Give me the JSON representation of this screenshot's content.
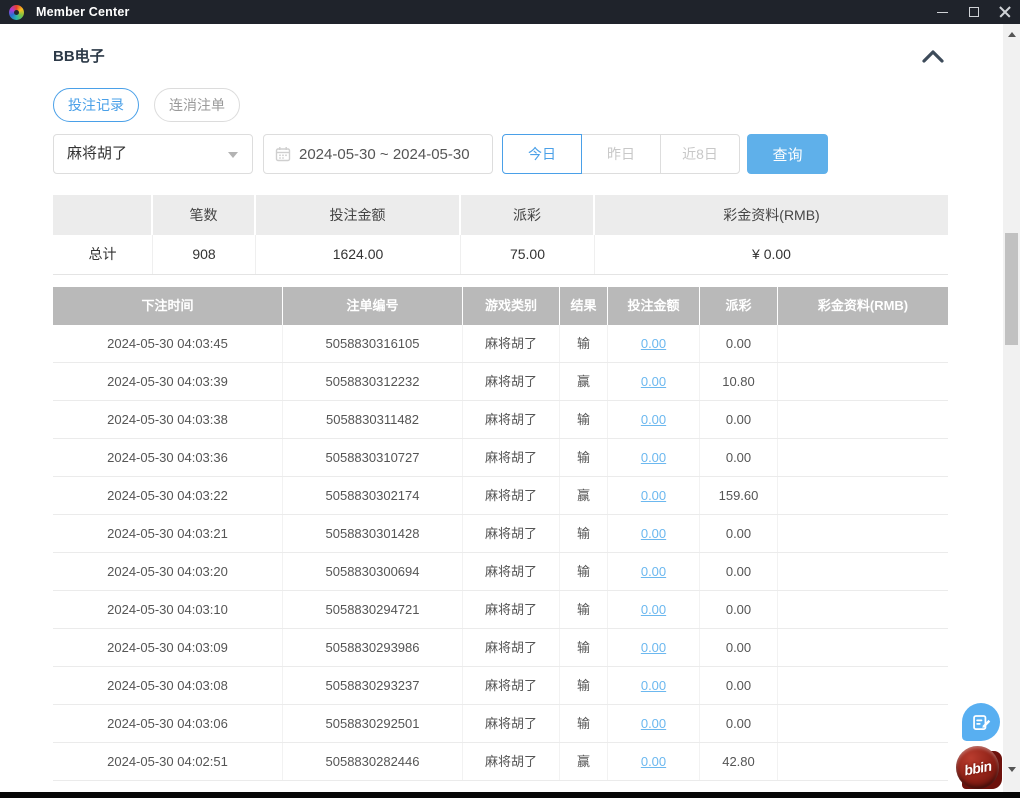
{
  "window": {
    "title": "Member Center"
  },
  "section": {
    "title": "BB电子"
  },
  "tabs": [
    {
      "label": "投注记录",
      "active": true
    },
    {
      "label": "连消注单",
      "active": false
    }
  ],
  "filters": {
    "game_select": {
      "value": "麻将胡了"
    },
    "date_range": {
      "value": "2024-05-30 ~ 2024-05-30"
    },
    "quick_ranges": [
      {
        "label": "今日",
        "active": true
      },
      {
        "label": "昨日",
        "active": false
      },
      {
        "label": "近8日",
        "active": false
      }
    ],
    "search_label": "查询"
  },
  "summary": {
    "headers": [
      "",
      "笔数",
      "投注金额",
      "派彩",
      "彩金资料(RMB)"
    ],
    "row": {
      "label": "总计",
      "count": "908",
      "bet_amount": "1624.00",
      "payout": "75.00",
      "bonus": "¥ 0.00"
    }
  },
  "table": {
    "headers": [
      "下注时间",
      "注单编号",
      "游戏类别",
      "结果",
      "投注金额",
      "派彩",
      "彩金资料(RMB)"
    ],
    "rows": [
      {
        "time": "2024-05-30 04:03:45",
        "bet_id": "5058830316105",
        "game": "麻将胡了",
        "result": "输",
        "bet_amount": "0.00",
        "payout": "0.00",
        "bonus": ""
      },
      {
        "time": "2024-05-30 04:03:39",
        "bet_id": "5058830312232",
        "game": "麻将胡了",
        "result": "赢",
        "bet_amount": "0.00",
        "payout": "10.80",
        "bonus": ""
      },
      {
        "time": "2024-05-30 04:03:38",
        "bet_id": "5058830311482",
        "game": "麻将胡了",
        "result": "输",
        "bet_amount": "0.00",
        "payout": "0.00",
        "bonus": ""
      },
      {
        "time": "2024-05-30 04:03:36",
        "bet_id": "5058830310727",
        "game": "麻将胡了",
        "result": "输",
        "bet_amount": "0.00",
        "payout": "0.00",
        "bonus": ""
      },
      {
        "time": "2024-05-30 04:03:22",
        "bet_id": "5058830302174",
        "game": "麻将胡了",
        "result": "赢",
        "bet_amount": "0.00",
        "payout": "159.60",
        "bonus": ""
      },
      {
        "time": "2024-05-30 04:03:21",
        "bet_id": "5058830301428",
        "game": "麻将胡了",
        "result": "输",
        "bet_amount": "0.00",
        "payout": "0.00",
        "bonus": ""
      },
      {
        "time": "2024-05-30 04:03:20",
        "bet_id": "5058830300694",
        "game": "麻将胡了",
        "result": "输",
        "bet_amount": "0.00",
        "payout": "0.00",
        "bonus": ""
      },
      {
        "time": "2024-05-30 04:03:10",
        "bet_id": "5058830294721",
        "game": "麻将胡了",
        "result": "输",
        "bet_amount": "0.00",
        "payout": "0.00",
        "bonus": ""
      },
      {
        "time": "2024-05-30 04:03:09",
        "bet_id": "5058830293986",
        "game": "麻将胡了",
        "result": "输",
        "bet_amount": "0.00",
        "payout": "0.00",
        "bonus": ""
      },
      {
        "time": "2024-05-30 04:03:08",
        "bet_id": "5058830293237",
        "game": "麻将胡了",
        "result": "输",
        "bet_amount": "0.00",
        "payout": "0.00",
        "bonus": ""
      },
      {
        "time": "2024-05-30 04:03:06",
        "bet_id": "5058830292501",
        "game": "麻将胡了",
        "result": "输",
        "bet_amount": "0.00",
        "payout": "0.00",
        "bonus": ""
      },
      {
        "time": "2024-05-30 04:02:51",
        "bet_id": "5058830282446",
        "game": "麻将胡了",
        "result": "赢",
        "bet_amount": "0.00",
        "payout": "42.80",
        "bonus": ""
      }
    ]
  },
  "floating": {
    "brand_text": "bbin"
  },
  "colors": {
    "titlebar_bg": "#1f232b",
    "accent_blue": "#4aa0e8",
    "button_blue": "#5fb0ea",
    "link_blue": "#6cb8ef",
    "table_header_bg": "#b9b9b9",
    "summary_header_bg": "#ececec",
    "brand_red": "#8c2016"
  }
}
